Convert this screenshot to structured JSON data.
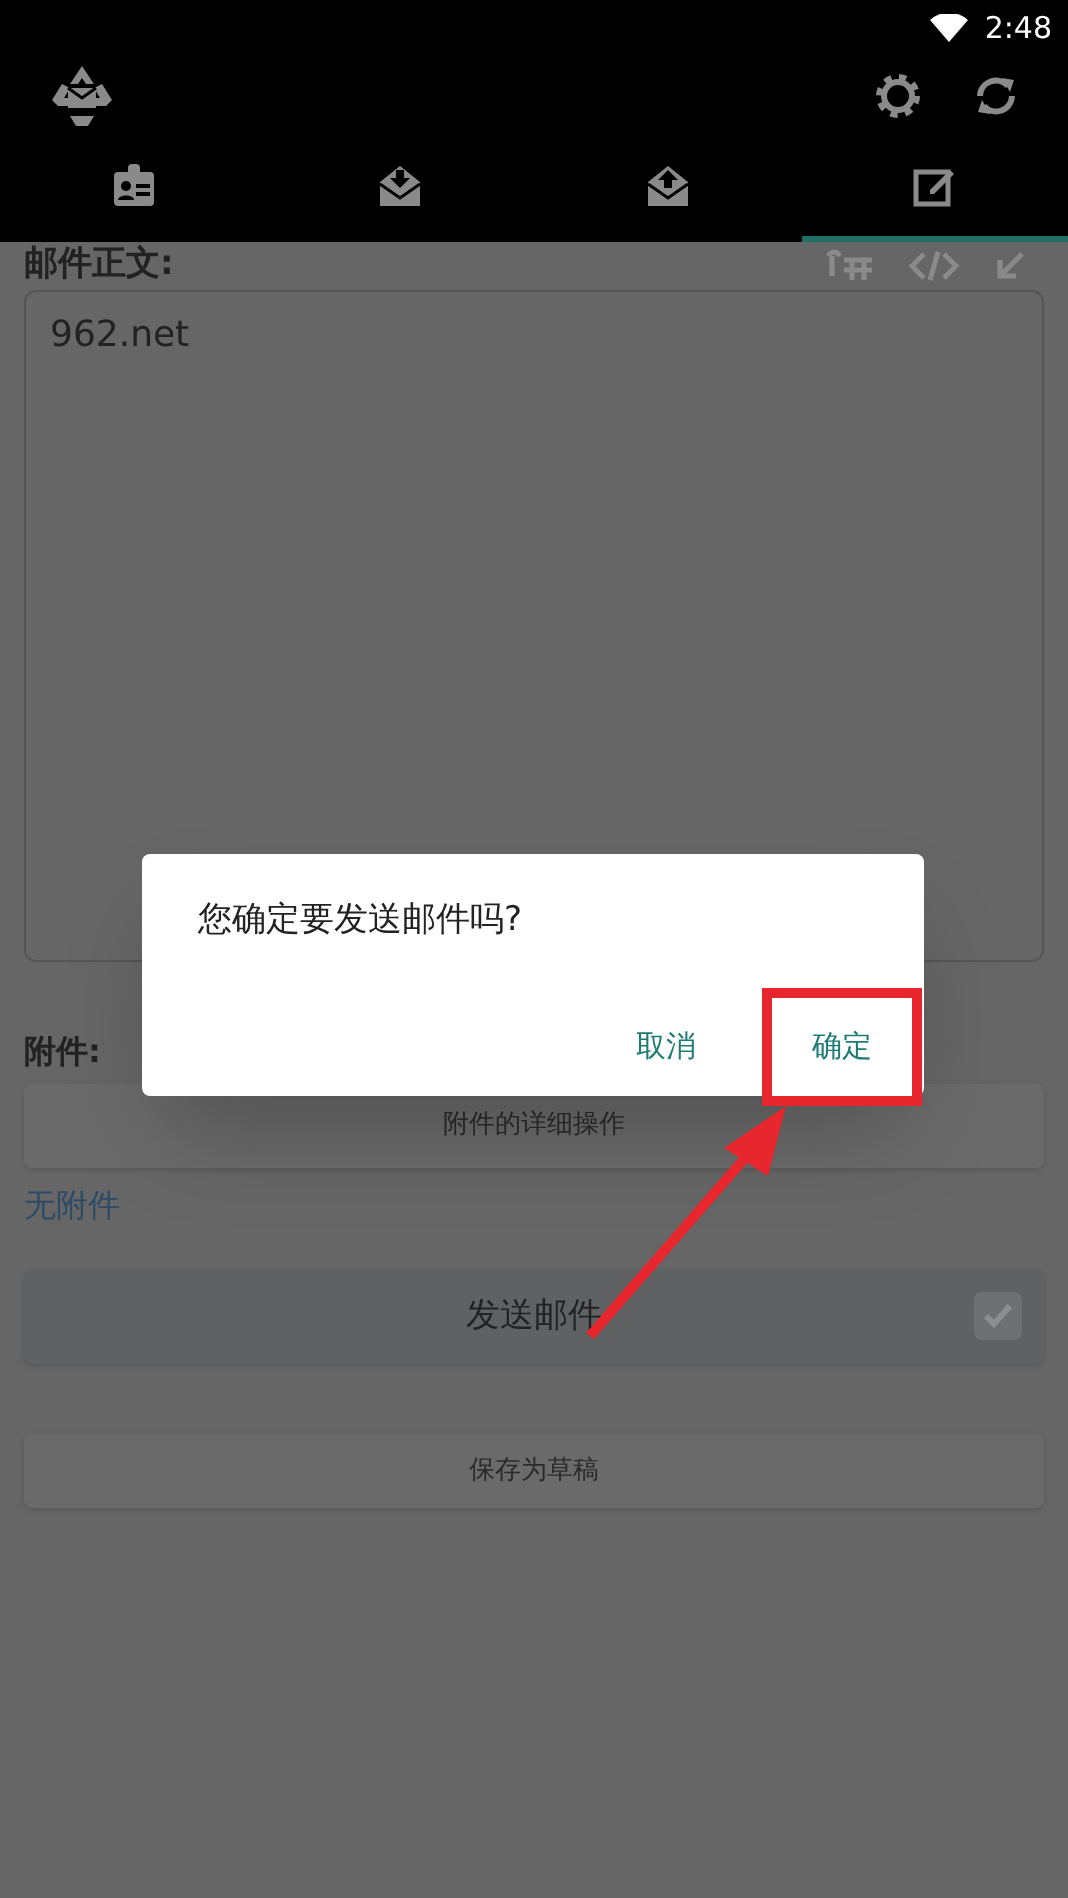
{
  "status_bar": {
    "time": "2:48"
  },
  "tabs": [
    {
      "kind": "contact",
      "selected": false
    },
    {
      "kind": "inbox",
      "selected": false
    },
    {
      "kind": "outbox",
      "selected": false
    },
    {
      "kind": "compose",
      "selected": true
    }
  ],
  "body": {
    "label": "邮件正文:",
    "value": "962.net"
  },
  "attachments": {
    "label": "附件:",
    "details_button": "附件的详细操作",
    "empty_text": "无附件"
  },
  "send_button": {
    "label": "发送邮件",
    "checked": true
  },
  "draft_button": "保存为草稿",
  "dialog": {
    "message": "您确定要发送邮件吗?",
    "buttons": [
      {
        "label": "取消",
        "highlighted": false
      },
      {
        "label": "确定",
        "highlighted": true
      }
    ]
  }
}
